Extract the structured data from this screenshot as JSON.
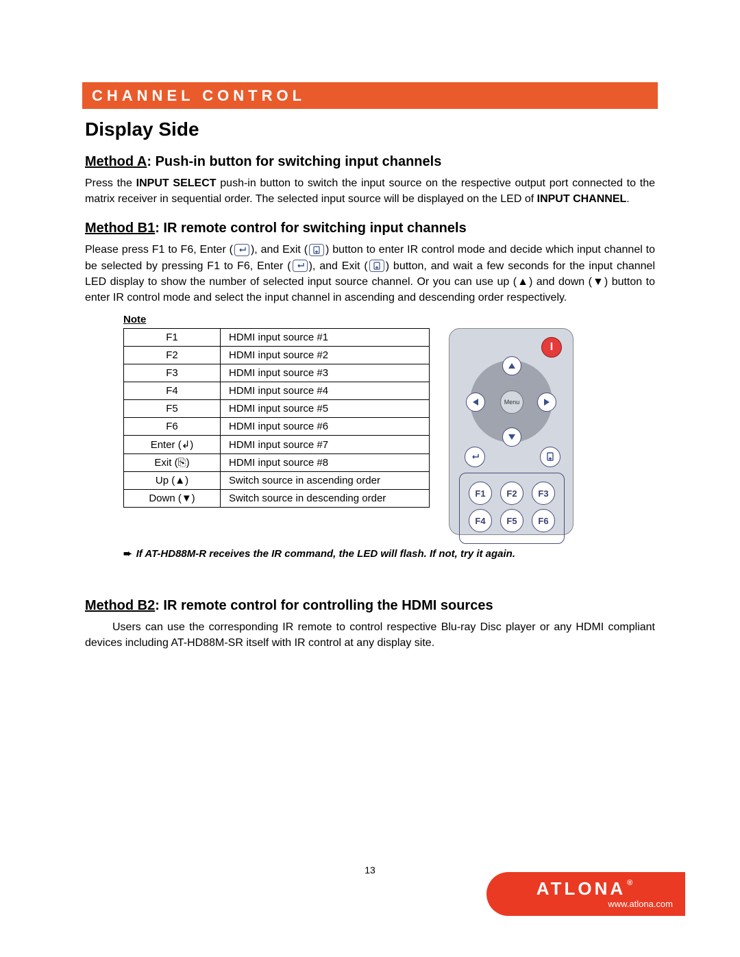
{
  "banner": "CHANNEL CONTROL",
  "h1": "Display Side",
  "methodA": {
    "label": "Method A",
    "title": ": Push-in button for switching input channels",
    "text_before_bold1": "Press the ",
    "bold1": "INPUT SELECT",
    "text_mid": " push-in button to switch the input source on the respective output port connected to the matrix receiver in sequential order. The selected input source will be displayed on the LED of ",
    "bold2": "INPUT CHANNEL",
    "text_after": "."
  },
  "methodB1": {
    "label": "Method B1",
    "title": ": IR remote control for switching input channels",
    "p1a": "Please press F1 to F6, Enter (",
    "p1b": "), and Exit (",
    "p1c": ") button to enter IR control mode and decide which input channel to be selected by pressing F1 to F6, Enter (",
    "p1d": "), and Exit (",
    "p1e": ") button, and wait a few seconds for the input channel LED display to show the number of selected input source channel. Or you can use up (▲) and down (▼) button to enter IR control mode and select the input channel in ascending and descending order respectively."
  },
  "note_label": "Note",
  "table": [
    {
      "k": "F1",
      "v": "HDMI input source #1"
    },
    {
      "k": "F2",
      "v": "HDMI input source #2"
    },
    {
      "k": "F3",
      "v": "HDMI input source #3"
    },
    {
      "k": "F4",
      "v": "HDMI input source #4"
    },
    {
      "k": "F5",
      "v": "HDMI input source #5"
    },
    {
      "k": "F6",
      "v": "HDMI input source #6"
    },
    {
      "k": "Enter (↲)",
      "v": "HDMI input source #7"
    },
    {
      "k": "Exit (⎘)",
      "v": "HDMI input source #8"
    },
    {
      "k": "Up (▲)",
      "v": "Switch source in ascending order"
    },
    {
      "k": "Down (▼)",
      "v": "Switch source in descending order"
    }
  ],
  "remote": {
    "power": "I",
    "menu": "Menu",
    "f": [
      "F1",
      "F2",
      "F3",
      "F4",
      "F5",
      "F6"
    ]
  },
  "tip_arrow": "➨",
  "tip": "If AT-HD88M-R receives the IR command, the LED will flash. If not, try it again.",
  "methodB2": {
    "label": "Method B2",
    "title": ": IR remote control for controlling the HDMI sources",
    "text": "Users can use the corresponding IR remote to control respective Blu-ray Disc player or any HDMI compliant devices including AT-HD88M-SR itself with IR control at any display site."
  },
  "page_number": "13",
  "brand": {
    "name": "ATLONA",
    "reg": "®",
    "url": "www.atlona.com"
  }
}
